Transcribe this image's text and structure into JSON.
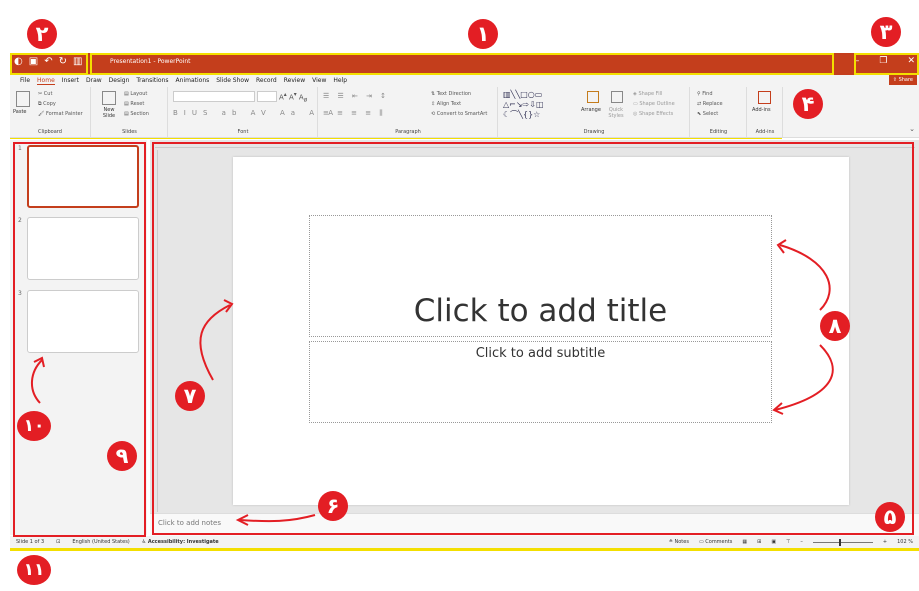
{
  "window": {
    "title": "Presentation1 - PowerPoint",
    "qat_icons": [
      "autosave-icon",
      "save-icon",
      "undo-icon",
      "redo-icon",
      "start-from-beginning-icon"
    ],
    "minimize": "–",
    "restore": "❐",
    "close": "✕"
  },
  "menu": {
    "tabs": [
      "File",
      "Home",
      "Insert",
      "Draw",
      "Design",
      "Transitions",
      "Animations",
      "Slide Show",
      "Record",
      "Review",
      "View",
      "Help"
    ],
    "active": "Home",
    "share": "Share"
  },
  "ribbon": {
    "clipboard": {
      "label": "Clipboard",
      "paste": "Paste",
      "cut": "Cut",
      "copy": "Copy",
      "format_painter": "Format Painter"
    },
    "slides": {
      "label": "Slides",
      "new_slide": "New Slide",
      "layout": "Layout",
      "reset": "Reset",
      "section": "Section"
    },
    "font": {
      "label": "Font"
    },
    "paragraph": {
      "label": "Paragraph",
      "text_direction": "Text Direction",
      "align_text": "Align Text",
      "convert_smartart": "Convert to SmartArt"
    },
    "drawing": {
      "label": "Drawing",
      "arrange": "Arrange",
      "quick_styles": "Quick Styles",
      "shape_fill": "Shape Fill",
      "shape_outline": "Shape Outline",
      "shape_effects": "Shape Effects"
    },
    "editing": {
      "label": "Editing",
      "find": "Find",
      "replace": "Replace",
      "select": "Select"
    },
    "addins": {
      "label": "Add-ins",
      "addins": "Add-ins"
    }
  },
  "thumbnails": {
    "numbers": [
      "1",
      "2",
      "3"
    ]
  },
  "slide": {
    "title_placeholder": "Click to add title",
    "subtitle_placeholder": "Click to add subtitle"
  },
  "notes": {
    "placeholder": "Click to add notes"
  },
  "status": {
    "slide_count": "Slide 1 of 3",
    "language": "English (United States)",
    "accessibility": "Accessibility: Investigate",
    "notes": "Notes",
    "comments": "Comments",
    "zoom": "102 %"
  },
  "annotations": [
    "١",
    "٢",
    "٣",
    "۴",
    "۵",
    "۶",
    "٧",
    "٨",
    "٩",
    "١٠",
    "١١"
  ],
  "colors": {
    "accent": "#c43e1c",
    "highlight": "#f3df00",
    "marker": "#e31e24"
  }
}
